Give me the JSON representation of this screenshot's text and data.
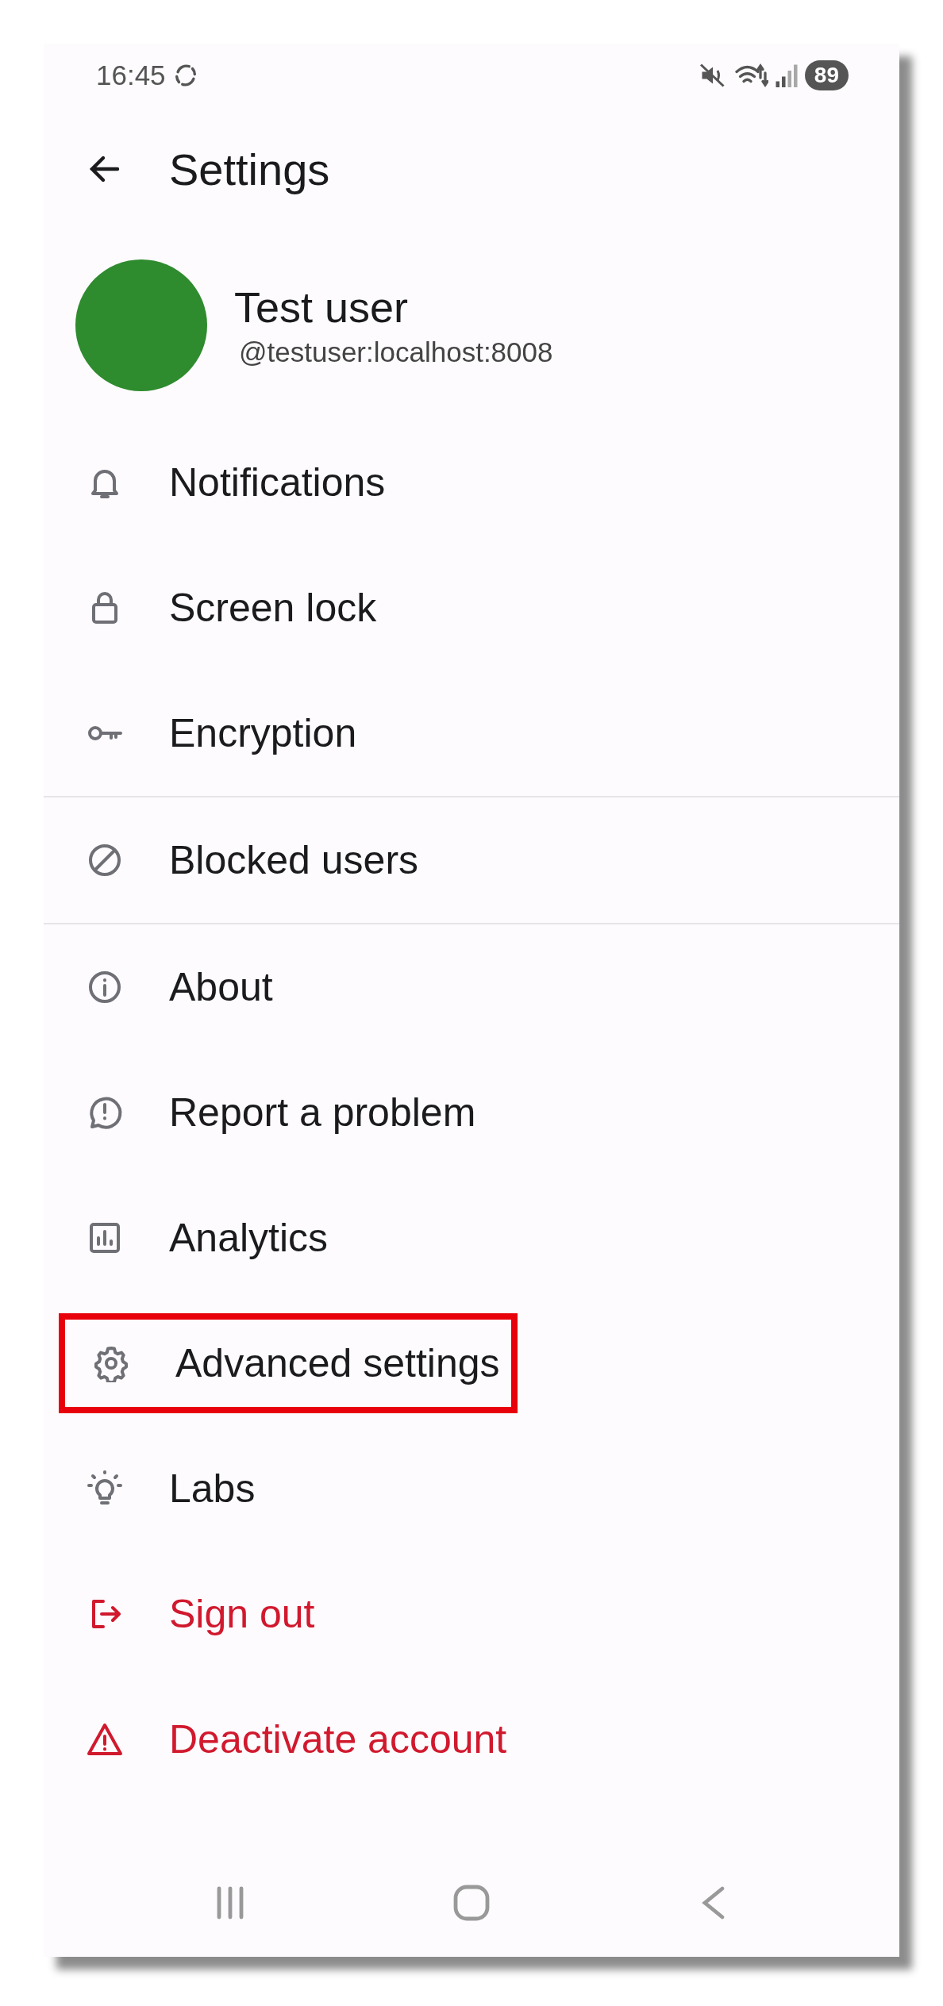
{
  "status_bar": {
    "time": "16:45",
    "battery": "89"
  },
  "header": {
    "title": "Settings"
  },
  "profile": {
    "name": "Test user",
    "user_id": "@testuser:localhost:8008"
  },
  "sections": [
    {
      "items": [
        {
          "label": "Notifications",
          "kind": "normal",
          "highlighted": false
        },
        {
          "label": "Screen lock",
          "kind": "normal",
          "highlighted": false
        },
        {
          "label": "Encryption",
          "kind": "normal",
          "highlighted": false
        }
      ]
    },
    {
      "items": [
        {
          "label": "Blocked users",
          "kind": "normal",
          "highlighted": false
        }
      ]
    },
    {
      "items": [
        {
          "label": "About",
          "kind": "normal",
          "highlighted": false
        },
        {
          "label": "Report a problem",
          "kind": "normal",
          "highlighted": false
        },
        {
          "label": "Analytics",
          "kind": "normal",
          "highlighted": false
        },
        {
          "label": "Advanced settings",
          "kind": "normal",
          "highlighted": true
        },
        {
          "label": "Labs",
          "kind": "normal",
          "highlighted": false
        },
        {
          "label": "Sign out",
          "kind": "danger",
          "highlighted": false
        },
        {
          "label": "Deactivate account",
          "kind": "danger",
          "highlighted": false
        }
      ]
    }
  ]
}
